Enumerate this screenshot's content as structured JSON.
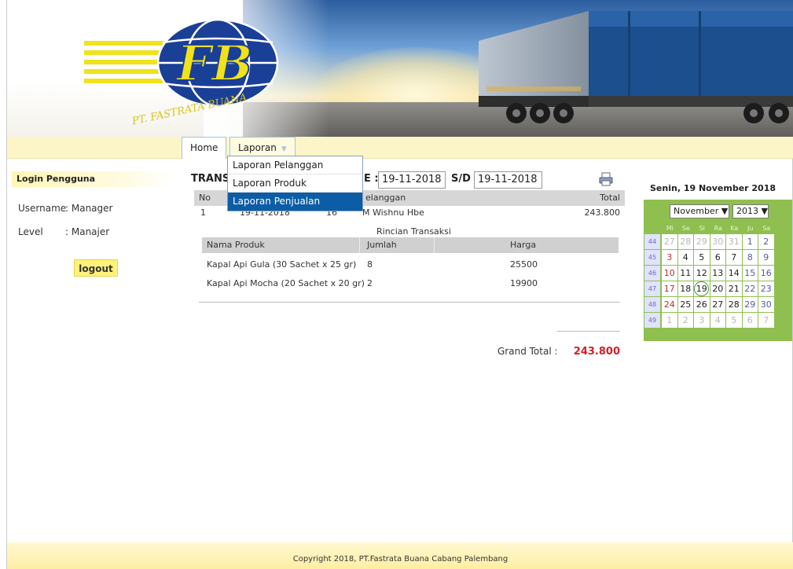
{
  "banner": {
    "company_name": "PT. FASTRATA BUANA",
    "logo_letters": "FB"
  },
  "nav": {
    "home": "Home",
    "laporan": "Laporan",
    "laporan_menu": [
      "Laporan Pelanggan",
      "Laporan Produk",
      "Laporan Penjualan"
    ],
    "active_menu_item": "Laporan Penjualan"
  },
  "sidebar": {
    "title": "Login Pengguna",
    "username_label": "Username",
    "username_value": ": Manager",
    "level_label": "Level",
    "level_value": ": Manajer",
    "logout": "logout"
  },
  "main": {
    "title": "TRANS",
    "date_label_end": "E :",
    "date_from": "19-11-2018",
    "sd_label": "S/D",
    "date_to": "19-11-2018",
    "columns": {
      "no": "No",
      "pelanggan": "elanggan",
      "total": "Total"
    },
    "row": {
      "no": "1",
      "tanggal": "19-11-2018",
      "kode": "16",
      "pelanggan": "M Wishnu Hbe",
      "total": "243.800"
    },
    "rincian_title": "Rincian Transaksi",
    "detail_columns": {
      "nama": "Nama Produk",
      "jumlah": "Jumlah",
      "harga": "Harga"
    },
    "details": [
      {
        "nama": "Kapal Api Gula (30 Sachet x 25 gr)",
        "jumlah": "8",
        "harga": "25500"
      },
      {
        "nama": "Kapal Api Mocha (20 Sachet x 20 gr)",
        "jumlah": "2",
        "harga": "19900"
      }
    ],
    "grand_total_label": "Grand Total :",
    "grand_total_value": "243.800"
  },
  "calendar": {
    "date_text": "Senin, 19 November 2018",
    "month": "November",
    "year": "2013",
    "dow": [
      "Mi",
      "Se",
      "Sl",
      "Ra",
      "Ka",
      "Ju",
      "Sa"
    ],
    "weeks": [
      {
        "wk": "44",
        "days": [
          "27",
          "28",
          "29",
          "30",
          "31",
          "1",
          "2"
        ]
      },
      {
        "wk": "45",
        "days": [
          "3",
          "4",
          "5",
          "6",
          "7",
          "8",
          "9"
        ]
      },
      {
        "wk": "46",
        "days": [
          "10",
          "11",
          "12",
          "13",
          "14",
          "15",
          "16"
        ]
      },
      {
        "wk": "47",
        "days": [
          "17",
          "18",
          "19",
          "20",
          "21",
          "22",
          "23"
        ]
      },
      {
        "wk": "48",
        "days": [
          "24",
          "25",
          "26",
          "27",
          "28",
          "29",
          "30"
        ]
      },
      {
        "wk": "49",
        "days": [
          "1",
          "2",
          "3",
          "4",
          "5",
          "6",
          "7"
        ]
      }
    ],
    "today": "19"
  },
  "footer": {
    "copyright": "Copyright 2018, PT.Fastrata Buana Cabang Palembang"
  },
  "colors": {
    "accent_yellow": "#fbf5c8",
    "menu_active": "#0c5da5",
    "grand_total": "#d0202a",
    "calendar_green": "#8fbf4f"
  }
}
